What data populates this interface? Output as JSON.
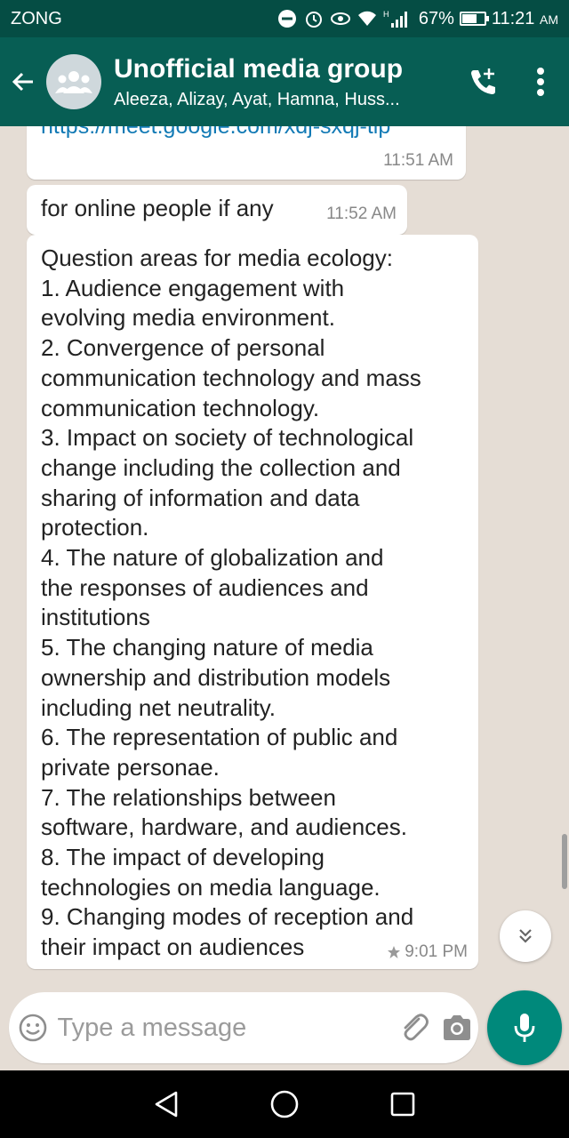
{
  "status_bar": {
    "carrier": "ZONG",
    "signal": "H",
    "battery": "67%",
    "battery_level": 0.67,
    "time": "11:21",
    "ampm": "AM"
  },
  "header": {
    "title": "Unofficial media group",
    "members": "Aleeza, Alizay, Ayat, Hamna, Huss..."
  },
  "messages": [
    {
      "text": "https://meet.google.com/xdj-sxqj-tip",
      "time": "11:51 AM"
    },
    {
      "text": "for online people if any",
      "time": "11:52 AM"
    },
    {
      "lines": [
        "Question areas for media ecology:",
        "1. Audience engagement with",
        "evolving media environment.",
        "2. Convergence of personal",
        "communication technology and mass",
        "communication technology.",
        "3. Impact on society of technological",
        "change including the collection and",
        "sharing of information and data",
        "protection.",
        "4. The nature of globalization and",
        "the responses of audiences and",
        "institutions",
        "5. The changing nature of media",
        "ownership and distribution models",
        "including net neutrality.",
        "6. The representation of public and",
        "private personae.",
        "7. The relationships between",
        "software, hardware, and audiences.",
        "8. The impact of developing",
        "technologies on media language.",
        "9. Changing modes of reception and",
        "their impact on audiences"
      ],
      "time": "9:01 PM",
      "starred": true
    }
  ],
  "composer": {
    "placeholder": "Type a message"
  },
  "colors": {
    "header": "#075e54",
    "status_bar": "#054d44",
    "chat_bg": "#e5ddd5",
    "mic": "#00897b",
    "link": "#127ab5"
  },
  "icons": [
    "back-arrow-icon",
    "group-avatar-icon",
    "add-call-icon",
    "more-vert-icon",
    "star-icon",
    "double-chevron-down-icon",
    "emoji-icon",
    "attach-icon",
    "camera-icon",
    "mic-icon",
    "nav-back-icon",
    "nav-home-icon",
    "nav-recents-icon"
  ]
}
